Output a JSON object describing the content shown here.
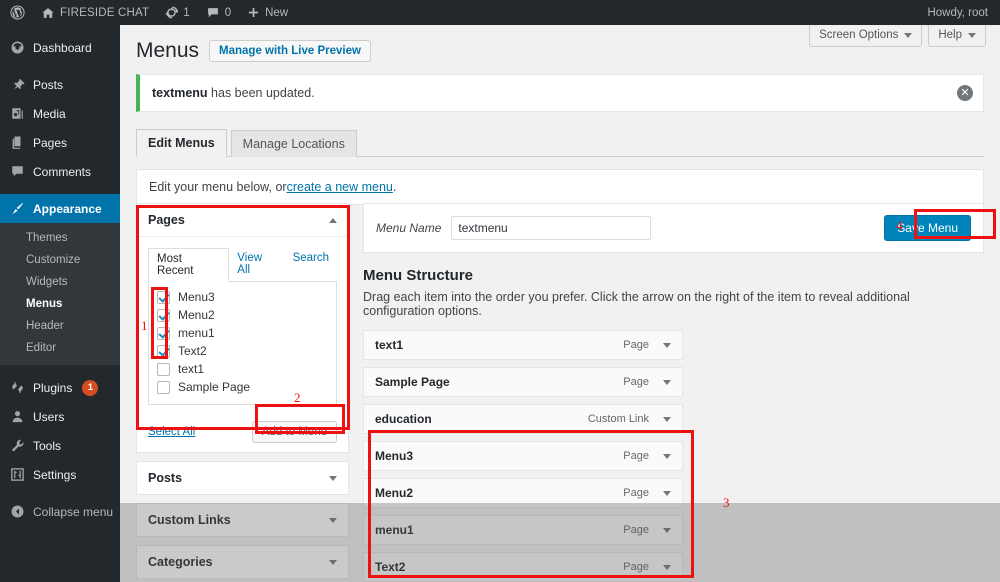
{
  "adminbar": {
    "logo_icon": "wordpress-logo-icon",
    "home_icon": "home-icon",
    "site_name": "FIRESIDE CHAT",
    "updates_icon": "updates-icon",
    "updates_count": "1",
    "comments_icon": "comment-bubble-icon",
    "comments_count": "0",
    "new_icon": "plus-icon",
    "new_label": "New",
    "account_label": "Howdy, root"
  },
  "sidebar": {
    "items": [
      {
        "label": "Dashboard",
        "icon": "dashboard-icon",
        "active": false
      },
      {
        "label": "Posts",
        "icon": "pin-icon",
        "active": false
      },
      {
        "label": "Media",
        "icon": "media-icon",
        "active": false
      },
      {
        "label": "Pages",
        "icon": "pages-icon",
        "active": false
      },
      {
        "label": "Comments",
        "icon": "comment-bubble-icon",
        "active": false
      },
      {
        "label": "Appearance",
        "icon": "paintbrush-icon",
        "active": true
      }
    ],
    "submenu": [
      {
        "label": "Themes",
        "current": false
      },
      {
        "label": "Customize",
        "current": false
      },
      {
        "label": "Widgets",
        "current": false
      },
      {
        "label": "Menus",
        "current": true
      },
      {
        "label": "Header",
        "current": false
      },
      {
        "label": "Editor",
        "current": false
      }
    ],
    "items_bottom": [
      {
        "label": "Plugins",
        "icon": "plug-icon",
        "badge": "1"
      },
      {
        "label": "Users",
        "icon": "user-icon",
        "badge": ""
      },
      {
        "label": "Tools",
        "icon": "wrench-icon",
        "badge": ""
      },
      {
        "label": "Settings",
        "icon": "sliders-icon",
        "badge": ""
      }
    ],
    "collapse": {
      "label": "Collapse menu",
      "icon": "collapse-arrow-icon"
    }
  },
  "screen_meta": {
    "screen_options": "Screen Options",
    "help": "Help"
  },
  "page": {
    "title": "Menus",
    "live_preview_button": "Manage with Live Preview",
    "notice_strong": "textmenu",
    "notice_rest": " has been updated.",
    "dismiss_icon": "close-circle-icon",
    "tabs": [
      {
        "label": "Edit Menus",
        "active": true
      },
      {
        "label": "Manage Locations",
        "active": false
      }
    ],
    "intro_prefix": "Edit your menu below, or ",
    "intro_link": "create a new menu",
    "intro_suffix": "."
  },
  "pages_panel": {
    "title": "Pages",
    "toggle_icon": "chevron-up-icon",
    "mini_tabs": [
      {
        "label": "Most Recent",
        "active": true
      },
      {
        "label": "View All",
        "active": false
      },
      {
        "label": "Search",
        "active": false
      }
    ],
    "items": [
      {
        "label": "Menu3",
        "checked": true
      },
      {
        "label": "Menu2",
        "checked": true
      },
      {
        "label": "menu1",
        "checked": true
      },
      {
        "label": "Text2",
        "checked": true
      },
      {
        "label": "text1",
        "checked": false
      },
      {
        "label": "Sample Page",
        "checked": false
      }
    ],
    "select_all": "Select All",
    "add_to_menu": "Add to Menu"
  },
  "other_panels": [
    {
      "title": "Posts",
      "toggle_icon": "chevron-down-icon"
    },
    {
      "title": "Custom Links",
      "toggle_icon": "chevron-down-icon"
    },
    {
      "title": "Categories",
      "toggle_icon": "chevron-down-icon"
    }
  ],
  "menu_editor": {
    "name_label": "Menu Name",
    "name_value": "textmenu",
    "name_placeholder": "Menu Name",
    "save_label": "Save Menu",
    "structure_title": "Menu Structure",
    "structure_desc": "Drag each item into the order you prefer. Click the arrow on the right of the item to reveal additional configuration options.",
    "items": [
      {
        "label": "text1",
        "type": "Page",
        "toggle_icon": "chevron-down-icon"
      },
      {
        "label": "Sample Page",
        "type": "Page",
        "toggle_icon": "chevron-down-icon"
      },
      {
        "label": "education",
        "type": "Custom Link",
        "toggle_icon": "chevron-down-icon"
      },
      {
        "label": "Menu3",
        "type": "Page",
        "toggle_icon": "chevron-down-icon"
      },
      {
        "label": "Menu2",
        "type": "Page",
        "toggle_icon": "chevron-down-icon"
      },
      {
        "label": "menu1",
        "type": "Page",
        "toggle_icon": "chevron-down-icon"
      },
      {
        "label": "Text2",
        "type": "Page",
        "toggle_icon": "chevron-down-icon"
      }
    ]
  },
  "annotations": {
    "n1": "1",
    "n2": "2",
    "n3": "3",
    "n4": "4"
  },
  "colors": {
    "accent": "#0073aa",
    "admin_bg": "#23282d",
    "annotation_red": "#ee1111",
    "success_green": "#46b450",
    "save_button": "#0085ba",
    "badge_orange": "#d54e21"
  }
}
